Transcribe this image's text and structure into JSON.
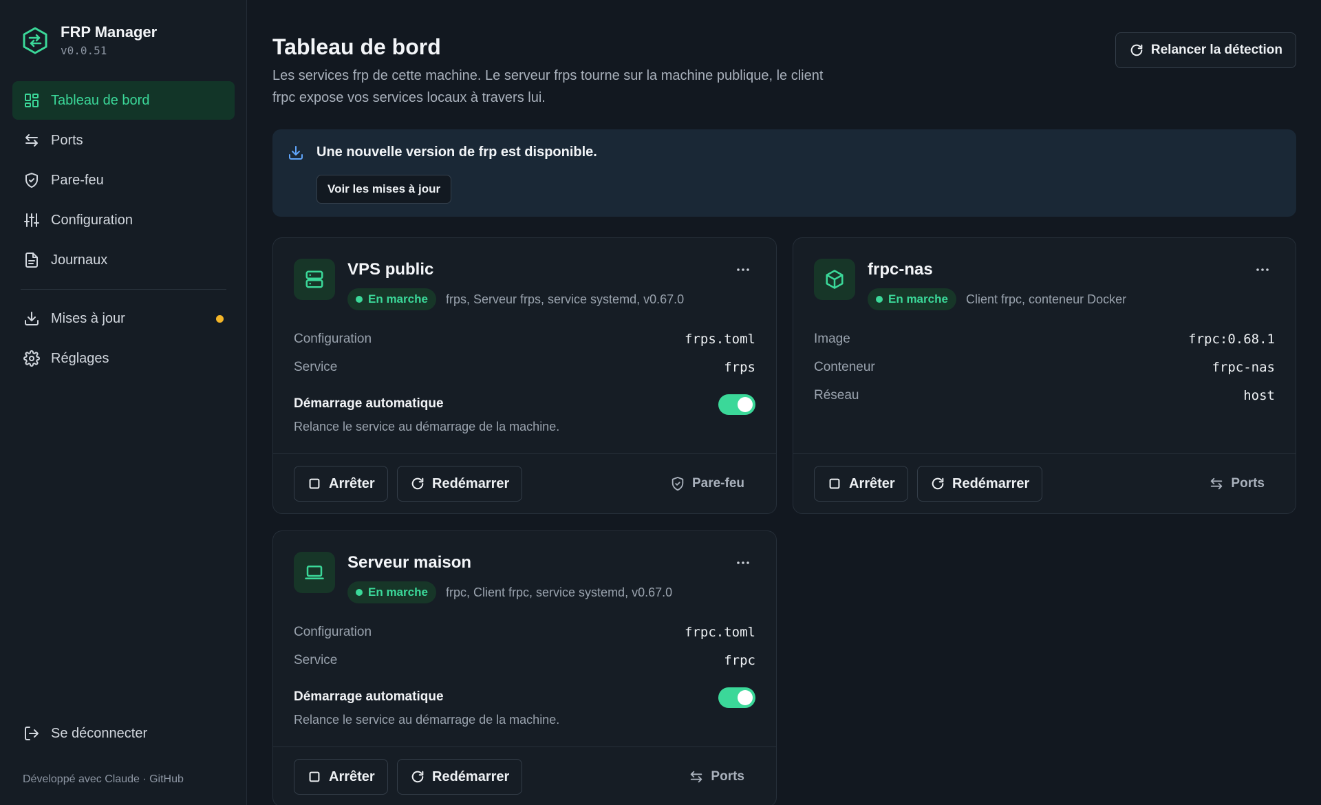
{
  "app": {
    "name": "FRP Manager",
    "version": "v0.0.51"
  },
  "sidebar": {
    "items": [
      {
        "label": "Tableau de bord",
        "icon": "grid-icon",
        "active": true
      },
      {
        "label": "Ports",
        "icon": "arrows-icon"
      },
      {
        "label": "Pare-feu",
        "icon": "shield-icon"
      },
      {
        "label": "Configuration",
        "icon": "sliders-icon"
      },
      {
        "label": "Journaux",
        "icon": "file-icon"
      }
    ],
    "items2": [
      {
        "label": "Mises à jour",
        "icon": "download-icon",
        "dot": true
      },
      {
        "label": "Réglages",
        "icon": "gear-icon"
      }
    ],
    "logout": "Se déconnecter",
    "footer_text": "Développé avec Claude",
    "footer_sep": " · ",
    "footer_link": "GitHub"
  },
  "header": {
    "title": "Tableau de bord",
    "description": "Les services frp de cette machine. Le serveur frps tourne sur la machine publique, le client frpc expose vos services locaux à travers lui.",
    "redetect": "Relancer la détection"
  },
  "banner": {
    "title": "Une nouvelle version de frp est disponible.",
    "button": "Voir les mises à jour"
  },
  "cards": {
    "vps": {
      "title": "VPS public",
      "status": "En marche",
      "subtitle": "frps, Serveur frps, service systemd, v0.67.0",
      "rows": [
        {
          "label": "Configuration",
          "value": "frps.toml"
        },
        {
          "label": "Service",
          "value": "frps"
        }
      ],
      "autostart_title": "Démarrage automatique",
      "autostart_desc": "Relance le service au démarrage de la machine.",
      "autostart_on": true,
      "stop": "Arrêter",
      "restart": "Redémarrer",
      "link": "Pare-feu"
    },
    "nas": {
      "title": "frpc-nas",
      "status": "En marche",
      "subtitle": "Client frpc, conteneur Docker",
      "rows": [
        {
          "label": "Image",
          "value": "frpc:0.68.1"
        },
        {
          "label": "Conteneur",
          "value": "frpc-nas"
        },
        {
          "label": "Réseau",
          "value": "host"
        }
      ],
      "stop": "Arrêter",
      "restart": "Redémarrer",
      "link": "Ports"
    },
    "home": {
      "title": "Serveur maison",
      "status": "En marche",
      "subtitle": "frpc, Client frpc, service systemd, v0.67.0",
      "rows": [
        {
          "label": "Configuration",
          "value": "frpc.toml"
        },
        {
          "label": "Service",
          "value": "frpc"
        }
      ],
      "autostart_title": "Démarrage automatique",
      "autostart_desc": "Relance le service au démarrage de la machine.",
      "autostart_on": true,
      "stop": "Arrêter",
      "restart": "Redémarrer",
      "link": "Ports"
    }
  },
  "colors": {
    "accent": "#3bd899",
    "background": "#121820",
    "card": "#161d25",
    "warning_dot": "#f4b528"
  }
}
